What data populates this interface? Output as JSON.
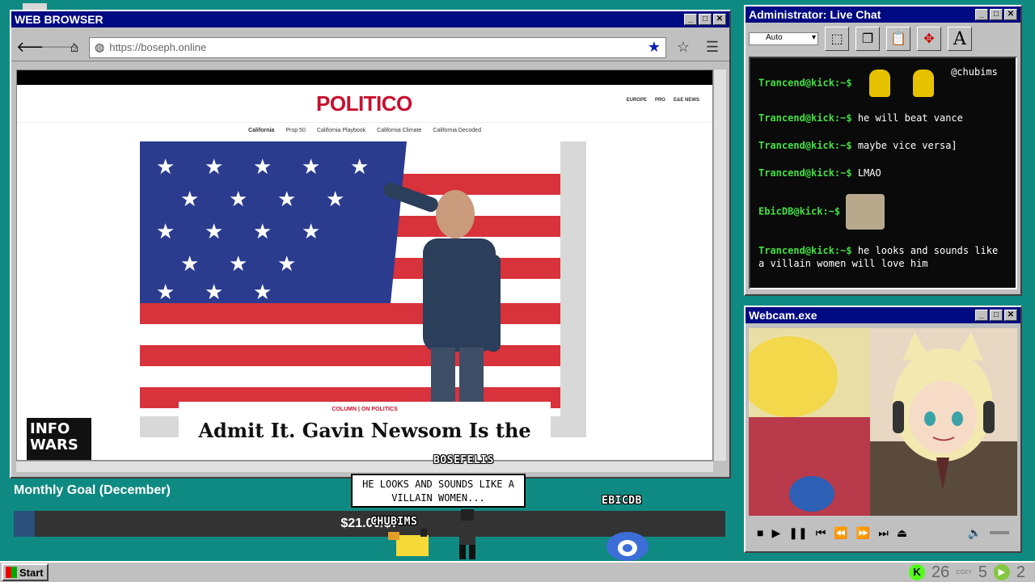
{
  "browser": {
    "title": "WEB BROWSER",
    "url": "https://boseph.online",
    "page": {
      "logo": "POLITICO",
      "top_links": [
        "EUROPE",
        "PRO",
        "E&E NEWS"
      ],
      "subnav": [
        "California",
        "Prop 50",
        "California Playbook",
        "California Climate",
        "California Decoded"
      ],
      "kicker": "COLUMN | ON POLITICS",
      "headline": "Admit It. Gavin Newsom Is the",
      "overlay_logo": "INFO WARS"
    }
  },
  "chat": {
    "title": "Administrator: Live Chat",
    "font_select": "Auto",
    "messages": [
      {
        "user": "Trancend@kick:~$",
        "text": "@chubims",
        "has_emotes": true
      },
      {
        "user": "Trancend@kick:~$",
        "text": "he will beat vance"
      },
      {
        "user": "Trancend@kick:~$",
        "text": "maybe vice versa]"
      },
      {
        "user": "Trancend@kick:~$",
        "text": "LMAO"
      },
      {
        "user": "EbicDB@kick:~$",
        "text": "",
        "has_image": true
      },
      {
        "user": "Trancend@kick:~$",
        "text": "he looks and sounds like a villain women will love him"
      }
    ]
  },
  "webcam": {
    "title": "Webcam.exe"
  },
  "goal": {
    "title": "Monthly Goal (December)",
    "amount": "$21.00/$7",
    "progress": 0.03
  },
  "overlay": {
    "name_top": "BOSEFELIS",
    "bubble": "HE LOOKS AND SOUNDS LIKE A VILLAIN WOMEN...",
    "name_left": "CHUBIMS",
    "name_right": "EBICDB"
  },
  "taskbar": {
    "start": "Start",
    "kick_count": "26",
    "cozy_label": "COZY",
    "cozy_count": "5",
    "rumble_count": "2"
  },
  "colors": {
    "desktop": "#0f8a82",
    "titlebar": "#000a82",
    "prompt": "#43e043",
    "politico": "#c8102e"
  }
}
